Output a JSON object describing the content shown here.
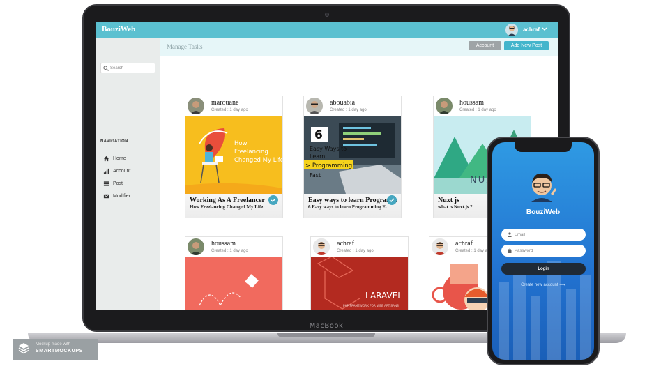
{
  "app": {
    "brand": "BouziWeb",
    "user_name": "achraf"
  },
  "sidebar": {
    "search_placeholder": "Search",
    "nav_heading": "NAVIGATION",
    "items": [
      {
        "label": "Home",
        "icon": "home-icon"
      },
      {
        "label": "Account",
        "icon": "signal-bars-icon"
      },
      {
        "label": "Post",
        "icon": "list-icon"
      },
      {
        "label": "Modifier",
        "icon": "envelope-icon"
      }
    ]
  },
  "subbar": {
    "title": "Manage Tasks",
    "account_button": "Account",
    "add_post_button": "Add New Post"
  },
  "posts": [
    {
      "author": "marouane",
      "meta": "Created : 1 day ago",
      "image_text": [
        "How",
        "Freelancing",
        "Changed My Life"
      ],
      "title": "Working As A Freelancer",
      "subtitle": "How Freelancing Changed My Life",
      "checked": true
    },
    {
      "author": "abouabia",
      "meta": "Created : 1 day ago",
      "image_text": [
        "6",
        "Easy Ways to",
        "Learn",
        "> Programming",
        "Fast"
      ],
      "title": "Easy ways to learn Programming",
      "subtitle": "6 Easy ways to learn Programming F...",
      "checked": true
    },
    {
      "author": "houssam",
      "meta": "Created : 1 day ago",
      "image_text": [
        "NUXT"
      ],
      "title": "Nuxt js",
      "subtitle": "what is Nuxt.js ?",
      "checked": false
    },
    {
      "author": "houssam",
      "meta": "Created : 1 day ago",
      "image_text": [],
      "title": "",
      "subtitle": "",
      "checked": false
    },
    {
      "author": "achraf",
      "meta": "Created : 1 day ago",
      "image_text": [
        "LARAVEL",
        "PHP FRAMEWORK FOR WEB ARTISANS"
      ],
      "title": "",
      "subtitle": "",
      "checked": false
    },
    {
      "author": "achraf",
      "meta": "Created : 1 day ago",
      "image_text": [],
      "title": "",
      "subtitle": "",
      "checked": false
    }
  ],
  "phone": {
    "brand": "BouziWeb",
    "email_placeholder": "Email",
    "password_placeholder": "Password",
    "login_button": "Login",
    "create_account_link": "Create new account ⟶"
  },
  "device": {
    "label": "MacBook"
  },
  "watermark": {
    "small": "Mockup made with",
    "big": "SMARTMOCKUPS"
  },
  "colors": {
    "topbar": "#5bc0d0",
    "add_button": "#43b5cc",
    "account_button": "#9ea4a6",
    "phone_gradient_top": "#2f9ae3",
    "phone_gradient_bottom": "#1a5fb8"
  }
}
